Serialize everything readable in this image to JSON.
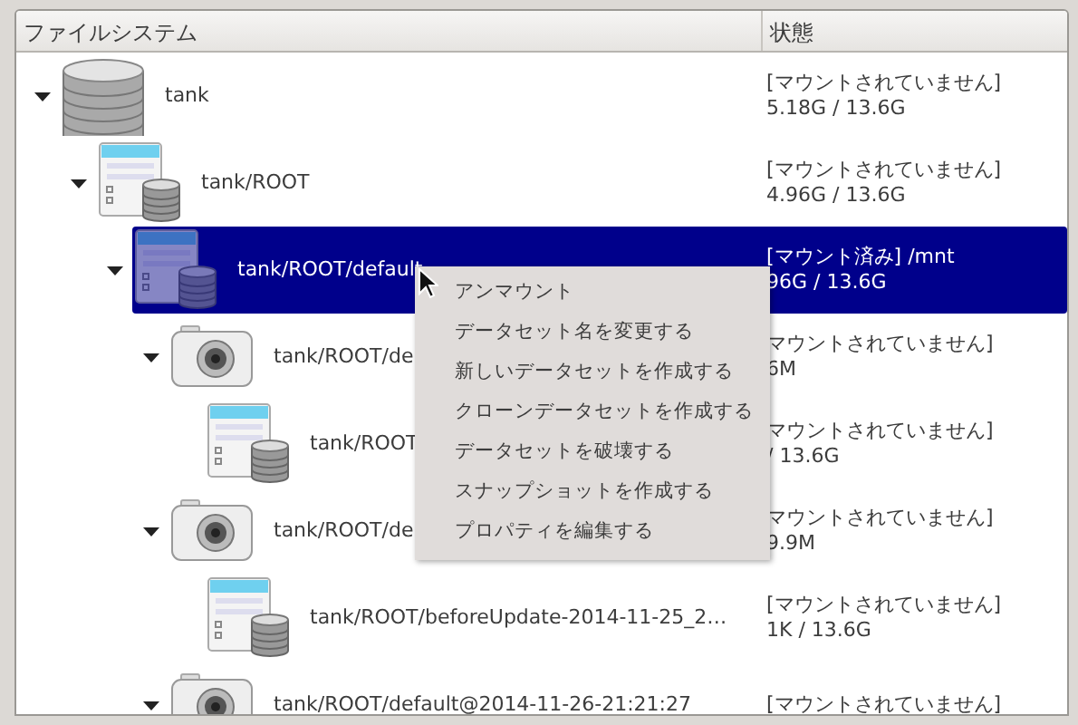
{
  "columns": [
    "ファイルシステム",
    "状態"
  ],
  "tree": [
    {
      "kind": "pool",
      "name": "tank",
      "status": "[マウントされていません]",
      "usage": "5.18G / 13.6G",
      "selected": false,
      "expanded": true,
      "children": [
        {
          "kind": "dataset",
          "name": "tank/ROOT",
          "status": "[マウントされていません]",
          "usage": "4.96G / 13.6G",
          "selected": false,
          "expanded": true,
          "children": [
            {
              "kind": "dataset",
              "name": "tank/ROOT/default",
              "status": "[マウント済み] /mnt",
              "usage": "96G / 13.6G",
              "selected": true,
              "expanded": true,
              "children": [
                {
                  "kind": "snapshot",
                  "name": "tank/ROOT/de",
                  "status": "マウントされていません]",
                  "usage": "6M",
                  "selected": false,
                  "expanded": true,
                  "children": [
                    {
                      "kind": "dataset",
                      "name": "tank/ROOT",
                      "status": "マウントされていません]",
                      "usage": "/ 13.6G",
                      "selected": false
                    }
                  ]
                },
                {
                  "kind": "snapshot",
                  "name": "tank/ROOT/de",
                  "status": "マウントされていません]",
                  "usage": "9.9M",
                  "selected": false,
                  "expanded": true,
                  "children": [
                    {
                      "kind": "dataset",
                      "name": "tank/ROOT/beforeUpdate-2014-11-25_2…",
                      "status": "[マウントされていません]",
                      "usage": "1K / 13.6G",
                      "selected": false
                    }
                  ]
                },
                {
                  "kind": "snapshot",
                  "name": "tank/ROOT/default@2014-11-26-21:21:27",
                  "status": "[マウントされていません]",
                  "selected": false,
                  "expanded": true
                }
              ]
            }
          ]
        }
      ]
    }
  ],
  "context_menu": [
    "アンマウント",
    "データセット名を変更する",
    "新しいデータセットを作成する",
    "クローンデータセットを作成する",
    "データセットを破壊する",
    "スナップショットを作成する",
    "プロパティを編集する"
  ]
}
